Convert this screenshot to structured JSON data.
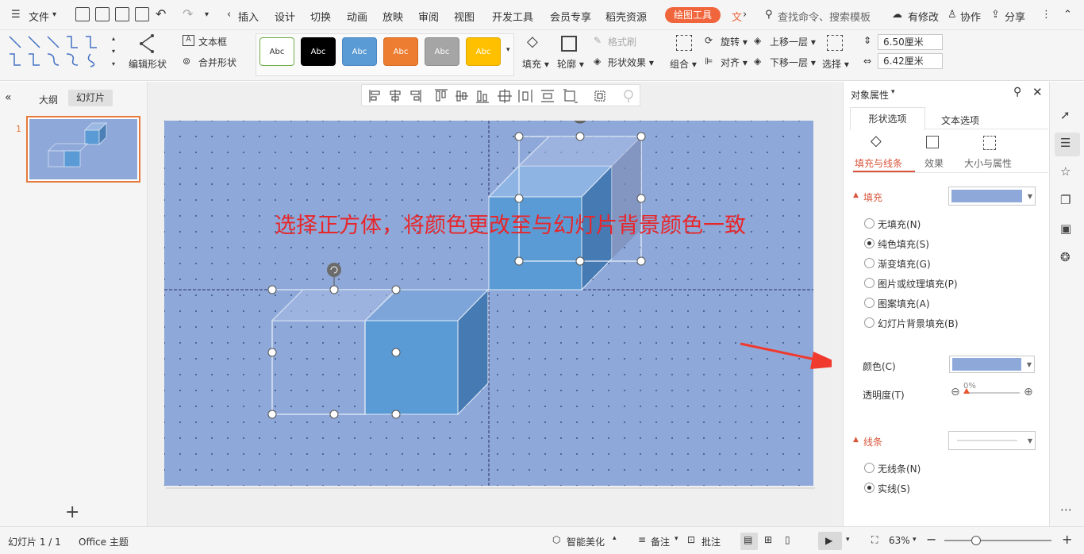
{
  "menu": {
    "file": "文件",
    "tabs": [
      "插入",
      "设计",
      "切换",
      "动画",
      "放映",
      "审阅",
      "视图",
      "开发工具",
      "会员专享",
      "稻壳资源"
    ],
    "active_tab": "绘图工具",
    "overflow_tab": "文",
    "search_placeholder": "查找命令、搜索模板",
    "user_items": [
      "有修改",
      "协作",
      "分享"
    ]
  },
  "ribbon": {
    "edit_shape": "编辑形状",
    "text_box": "文本框",
    "merge_shape": "合并形状",
    "style_labels": [
      "Abc",
      "Abc",
      "Abc",
      "Abc",
      "Abc",
      "Abc"
    ],
    "style_colors": [
      {
        "fill": "#ffffff",
        "border": "#70ad47",
        "text": "#333"
      },
      {
        "fill": "#000000",
        "border": "#000000",
        "text": "#fff"
      },
      {
        "fill": "#5b9bd5",
        "border": "#4a86c0",
        "text": "#fff"
      },
      {
        "fill": "#ed7d31",
        "border": "#d46a22",
        "text": "#fff"
      },
      {
        "fill": "#a5a5a5",
        "border": "#8e8e8e",
        "text": "#fff"
      },
      {
        "fill": "#ffc000",
        "border": "#e0a800",
        "text": "#fff"
      }
    ],
    "fill": "填充",
    "outline": "轮廓",
    "format_brush": "格式刷",
    "shape_effect": "形状效果",
    "group": "组合",
    "rotate": "旋转",
    "align": "对齐",
    "bring_forward": "上移一层",
    "send_backward": "下移一层",
    "select": "选择",
    "height_value": "6.50厘米",
    "width_value": "6.42厘米"
  },
  "left": {
    "tab_outline": "大纲",
    "tab_slides": "幻灯片",
    "slide_number": "1",
    "add_label": "+"
  },
  "slide": {
    "annotation": "选择正方体，将颜色更改至与幻灯片背景颜色一致",
    "bg_color": "#8ea9d9",
    "cube_color": "#5b9bd5"
  },
  "panel": {
    "title": "对象属性",
    "tab_shape": "形状选项",
    "tab_text": "文本选项",
    "sub_fill_line": "填充与线条",
    "sub_effect": "效果",
    "sub_size": "大小与属性",
    "fill_section": "填充",
    "fill_options": [
      "无填充(N)",
      "纯色填充(S)",
      "渐变填充(G)",
      "图片或纹理填充(P)",
      "图案填充(A)",
      "幻灯片背景填充(B)"
    ],
    "fill_selected": 1,
    "color_label": "颜色(C)",
    "transparency_label": "透明度(T)",
    "transparency_value": "0%",
    "fill_color": "#8ea9d9",
    "line_section": "线条",
    "line_options": [
      "无线条(N)",
      "实线(S)"
    ],
    "line_selected": 1,
    "line_color": "#eeeeee"
  },
  "status": {
    "slide_info": "幻灯片 1 / 1",
    "theme": "Office 主题",
    "beautify": "智能美化",
    "notes": "备注",
    "comments": "批注",
    "zoom": "63%"
  }
}
